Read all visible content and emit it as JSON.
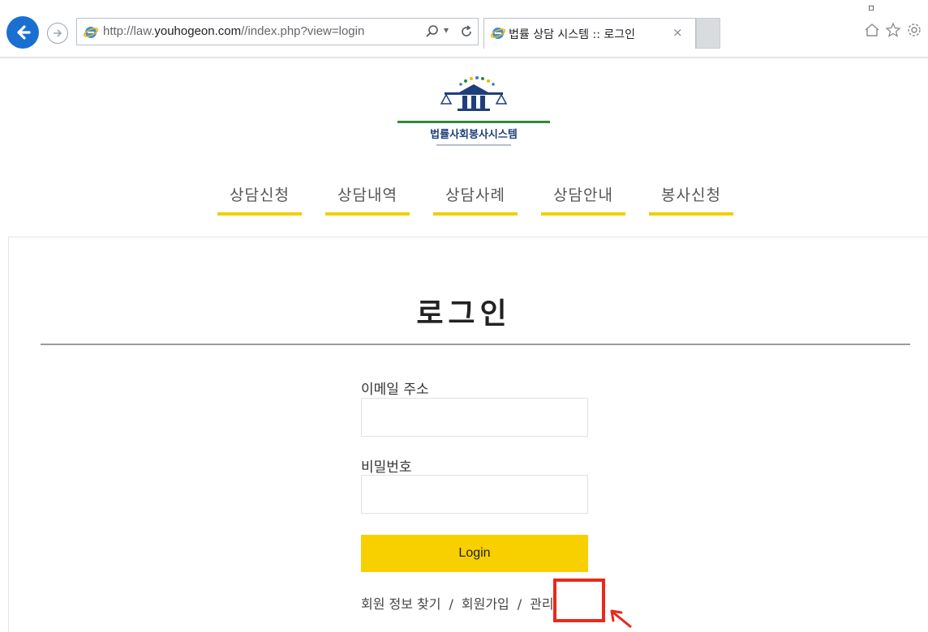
{
  "browser": {
    "url_prefix": "http://law.",
    "url_host": "youhogeon.com",
    "url_suffix": "//index.php?view=login",
    "tab_title": "법률 상담 시스템 :: 로그인",
    "tab_close": "×",
    "address_dropdown": "▾"
  },
  "site": {
    "logo_text": "법률사회봉사시스템",
    "nav": [
      {
        "label": "상담신청"
      },
      {
        "label": "상담내역"
      },
      {
        "label": "상담사례"
      },
      {
        "label": "상담안내"
      },
      {
        "label": "봉사신청"
      }
    ],
    "accent_color": "#f8d000"
  },
  "login": {
    "title": "로그인",
    "email_label": "이메일 주소",
    "email_value": "",
    "password_label": "비밀번호",
    "password_value": "",
    "button_label": "Login",
    "links": {
      "find_account": "회원 정보 찾기",
      "signup": "회원가입",
      "admin": "관리",
      "separator": "/"
    }
  },
  "annotation": {
    "highlight_color": "#e8291c"
  }
}
